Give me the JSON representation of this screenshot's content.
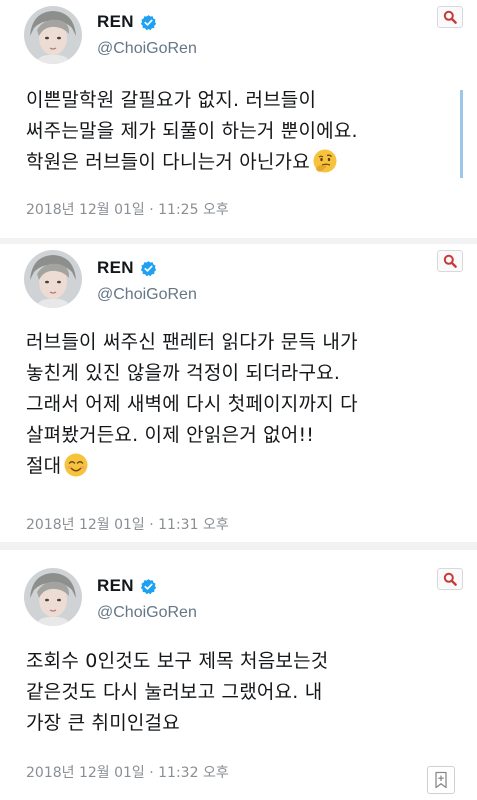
{
  "colors": {
    "verified": "#1da1f2",
    "search_icon": "#c83a3a",
    "quote_bar": "#9dc7ea",
    "text": "#14171a",
    "muted": "#657786"
  },
  "tweets": [
    {
      "name": "REN",
      "handle": "@ChoiGoRen",
      "lines": [
        "이쁜말학원 갈필요가 없지. 러브들이",
        "써주는말을 제가 되풀이 하는거 뿐이에요.",
        "학원은 러브들이 다니는거 아닌가요"
      ],
      "emoji": "thinking-face",
      "timestamp": "2018년 12월 01일 · 11:25 오후"
    },
    {
      "name": "REN",
      "handle": "@ChoiGoRen",
      "lines": [
        "러브들이 써주신 팬레터 읽다가 문득 내가",
        "놓친게 있진 않을까 걱정이 되더라구요.",
        "그래서 어제 새벽에 다시 첫페이지까지 다",
        "살펴봤거든요. 이제 안읽은거 없어!!",
        "절대"
      ],
      "emoji": "smiling-face",
      "timestamp": "2018년 12월 01일 · 11:31 오후"
    },
    {
      "name": "REN",
      "handle": "@ChoiGoRen",
      "lines": [
        "조회수 0인것도 보구 제목 처음보는것",
        "같은것도 다시 눌러보고 그랬어요. 내",
        "가장 큰 취미인걸요"
      ],
      "timestamp": "2018년 12월 01일 · 11:32 오후"
    }
  ],
  "icons": {
    "search": "search-icon",
    "verified": "verified-badge-icon",
    "bookmark": "bookmark-add-icon"
  }
}
